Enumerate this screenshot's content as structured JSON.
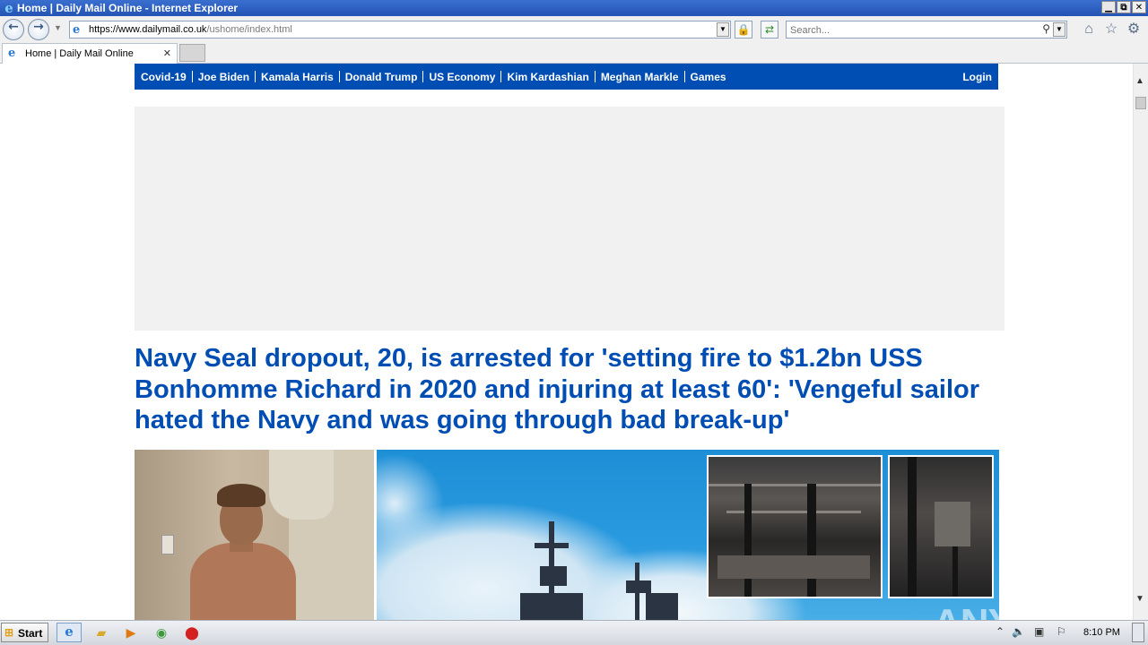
{
  "window": {
    "title": "Home | Daily Mail Online - Internet Explorer",
    "controls": {
      "minimize": "▁",
      "restore": "⧉",
      "close": "✕"
    }
  },
  "toolbar": {
    "url_host": "https://www.dailymail.co.uk",
    "url_path": "/ushome/index.html",
    "search_placeholder": "Search..."
  },
  "tabs": [
    {
      "label": "Home | Daily Mail Online"
    }
  ],
  "site_nav": {
    "items": [
      "Covid-19",
      "Joe Biden",
      "Kamala Harris",
      "Donald Trump",
      "US Economy",
      "Kim Kardashian",
      "Meghan Markle",
      "Games"
    ],
    "login": "Login",
    "color": "#004db3"
  },
  "article": {
    "headline": "Navy Seal dropout, 20, is arrested for  'setting fire to $1.2bn USS Bonhomme Richard in 2020 and injuring at least 60': 'Vengeful sailor hated the Navy and was going through bad break-up'"
  },
  "watermark": "ANY.RUN",
  "taskbar": {
    "start_label": "Start",
    "clock": "8:10 PM"
  },
  "icons": [
    "ie-logo-icon",
    "back-icon",
    "forward-icon",
    "lock-icon",
    "refresh-icon",
    "search-icon",
    "home-icon",
    "favorites-star-icon",
    "settings-gear-icon",
    "close-tab-icon",
    "windows-flag-icon",
    "folder-icon",
    "media-player-icon",
    "chrome-icon",
    "stop-icon"
  ]
}
